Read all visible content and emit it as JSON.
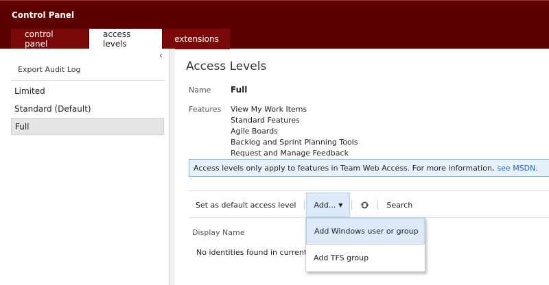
{
  "app": {
    "title": "Control Panel"
  },
  "tabs": [
    {
      "label": "control panel"
    },
    {
      "label": "access levels"
    },
    {
      "label": "extensions"
    }
  ],
  "sidebar": {
    "collapse_glyph": "‹",
    "export_label": "Export Audit Log",
    "items": [
      {
        "label": "Limited"
      },
      {
        "label": "Standard (Default)"
      },
      {
        "label": "Full"
      }
    ]
  },
  "main": {
    "title": "Access Levels",
    "name_label": "Name",
    "name_value": "Full",
    "features_label": "Features",
    "features": [
      "View My Work Items",
      "Standard Features",
      "Agile Boards",
      "Backlog and Sprint Planning Tools",
      "Request and Manage Feedback"
    ],
    "info_text": "Access levels only apply to features in Team Web Access. For more information,",
    "info_link": "see MSDN",
    "info_period": "."
  },
  "toolbar": {
    "set_default_label": "Set as default access level",
    "add_label": "Add...",
    "search_label": "Search"
  },
  "grid": {
    "column_header": "Display Name",
    "empty_message": "No identities found in current"
  },
  "add_menu": {
    "items": [
      {
        "label": "Add Windows user or group"
      },
      {
        "label": "Add TFS group"
      }
    ]
  },
  "colors": {
    "header_bg": "#5c0000",
    "tab_bg": "#7a0a0a",
    "info_bg": "#e6f1fb",
    "link": "#1b65b8"
  }
}
